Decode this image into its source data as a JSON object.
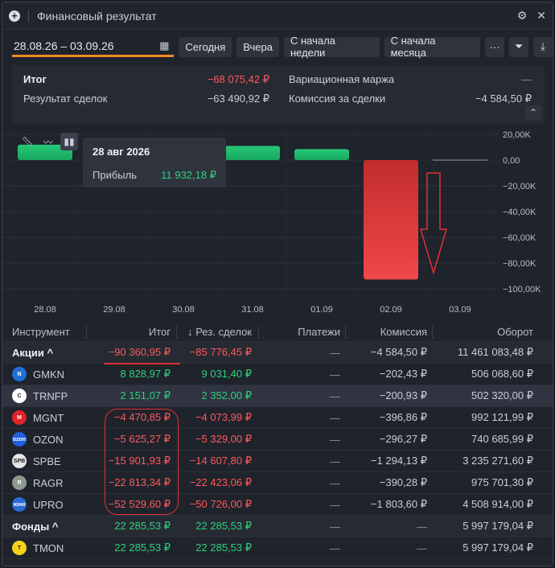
{
  "window": {
    "title": "Финансовый результат"
  },
  "toolbar": {
    "date_range": "28.08.26 – 03.09.26",
    "buttons": [
      "Сегодня",
      "Вчера",
      "С начала недели",
      "С начала месяца"
    ],
    "more_label": "···"
  },
  "summary": {
    "total_label": "Итог",
    "total_value": "−68 075,42 ₽",
    "deals_label": "Результат сделок",
    "deals_value": "−63 490,92 ₽",
    "margin_label": "Вариационная маржа",
    "margin_value": "—",
    "commission_label": "Комиссия за сделки",
    "commission_value": "−4 584,50 ₽"
  },
  "tooltip": {
    "date": "28 авг 2026",
    "label": "Прибыль",
    "value": "11 932,18 ₽"
  },
  "chart_data": {
    "type": "bar",
    "categories": [
      "28.08",
      "29.08",
      "30.08",
      "31.08",
      "01.09",
      "02.09",
      "03.09"
    ],
    "values": [
      11932.18,
      10500,
      0,
      11000,
      8500,
      -92700,
      -1200
    ],
    "ylim": [
      -100000,
      20000
    ],
    "y_ticks": [
      "20,00K",
      "0,00",
      "−20,00K",
      "−40,00K",
      "−60,00K",
      "−80,00K",
      "−100,00K"
    ],
    "grid": true,
    "colors": {
      "positive": "#1fb86a",
      "negative": "#e23c3c",
      "flat": "#5a6070"
    }
  },
  "table": {
    "headers": {
      "instrument": "Инструмент",
      "total": "Итог",
      "deals": "↓ Рез. сделок",
      "payments": "Платежи",
      "commission": "Комиссия",
      "turnover": "Оборот"
    },
    "groups": [
      {
        "name": "Акции ^",
        "total": "−90 360,95 ₽",
        "deals": "−85 776,45 ₽",
        "payments": "—",
        "commission": "−4 584,50 ₽",
        "turnover": "11 461 083,48 ₽",
        "rows": [
          {
            "ticker": "GMKN",
            "logo": "N",
            "logo_color": "#1e6fd9",
            "total": "8 828,97 ₽",
            "deals": "9 031,40 ₽",
            "payments": "—",
            "commission": "−202,43 ₽",
            "turnover": "506 068,60 ₽",
            "sign": "pos"
          },
          {
            "ticker": "TRNFP",
            "logo": "C",
            "logo_color": "#ffffff",
            "total": "2 151,07 ₽",
            "deals": "2 352,00 ₽",
            "payments": "—",
            "commission": "−200,93 ₽",
            "turnover": "502 320,00 ₽",
            "sign": "pos"
          },
          {
            "ticker": "MGNT",
            "logo": "M",
            "logo_color": "#e0242a",
            "total": "−4 470,85 ₽",
            "deals": "−4 073,99 ₽",
            "payments": "—",
            "commission": "−396,86 ₽",
            "turnover": "992 121,99 ₽",
            "sign": "neg"
          },
          {
            "ticker": "OZON",
            "logo": "ozon",
            "logo_color": "#1f5fe0",
            "total": "−5 625,27 ₽",
            "deals": "−5 329,00 ₽",
            "payments": "—",
            "commission": "−296,27 ₽",
            "turnover": "740 685,99 ₽",
            "sign": "neg"
          },
          {
            "ticker": "SPBE",
            "logo": "SPB",
            "logo_color": "#e6e6e6",
            "total": "−15 901,93 ₽",
            "deals": "−14 607,80 ₽",
            "payments": "—",
            "commission": "−1 294,13 ₽",
            "turnover": "3 235 271,60 ₽",
            "sign": "neg"
          },
          {
            "ticker": "RAGR",
            "logo": "R",
            "logo_color": "#8d9a8d",
            "total": "−22 813,34 ₽",
            "deals": "−22 423,06 ₽",
            "payments": "—",
            "commission": "−390,28 ₽",
            "turnover": "975 701,30 ₽",
            "sign": "neg"
          },
          {
            "ticker": "UPRO",
            "logo": "юни",
            "logo_color": "#2a6bd6",
            "total": "−52 529,60 ₽",
            "deals": "−50 726,00 ₽",
            "payments": "—",
            "commission": "−1 803,60 ₽",
            "turnover": "4 508 914,00 ₽",
            "sign": "neg"
          }
        ]
      },
      {
        "name": "Фонды ^",
        "total": "22 285,53 ₽",
        "deals": "22 285,53 ₽",
        "payments": "—",
        "commission": "—",
        "turnover": "5 997 179,04 ₽",
        "rows": [
          {
            "ticker": "TMON",
            "logo": "T",
            "logo_color": "#f5d21a",
            "total": "22 285,53 ₽",
            "deals": "22 285,53 ₽",
            "payments": "—",
            "commission": "—",
            "turnover": "5 997 179,04 ₽",
            "sign": "pos"
          }
        ]
      }
    ]
  }
}
